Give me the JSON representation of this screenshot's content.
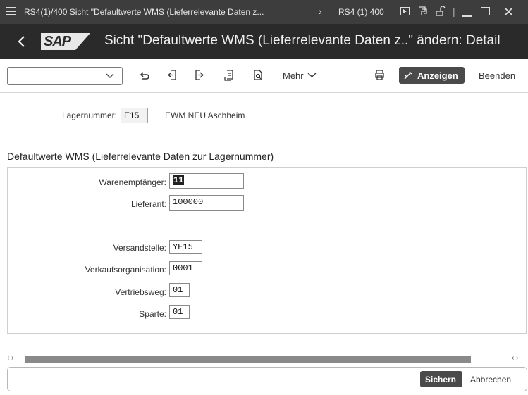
{
  "window": {
    "title": "RS4(1)/400 Sicht \"Defaultwerte WMS (Lieferrelevante Daten z...",
    "system": "RS4 (1) 400",
    "menu_icon": "hamburger-icon",
    "separator": "|"
  },
  "header": {
    "logo": "SAP",
    "title": "Sicht \"Defaultwerte WMS (Lieferrelevante Daten z..\" ändern: Detail"
  },
  "toolbar": {
    "command_field_value": "",
    "more_label": "Mehr",
    "display_label": "Anzeigen",
    "exit_label": "Beenden"
  },
  "warehouse": {
    "label": "Lagernummer:",
    "value": "E15",
    "description": "EWM NEU Aschheim"
  },
  "section": {
    "title": "Defaultwerte WMS (Lieferrelevante Daten zur Lagernummer)"
  },
  "fields": {
    "goods_recipient": {
      "label": "Warenempfänger:",
      "value": "11"
    },
    "supplier": {
      "label": "Lieferant:",
      "value": "100000"
    },
    "shipping_point": {
      "label": "Versandstelle:",
      "value": "YE15"
    },
    "sales_org": {
      "label": "Verkaufsorganisation:",
      "value": "0001"
    },
    "distribution_channel": {
      "label": "Vertriebsweg:",
      "value": "01"
    },
    "division": {
      "label": "Sparte:",
      "value": "01"
    }
  },
  "footer": {
    "save_label": "Sichern",
    "cancel_label": "Abbrechen"
  },
  "colors": {
    "titlebar": "#3d3d3d",
    "header": "#2a2a2a",
    "primary_button": "#4a4a4a",
    "logo_bg": "#e8e8e8"
  }
}
